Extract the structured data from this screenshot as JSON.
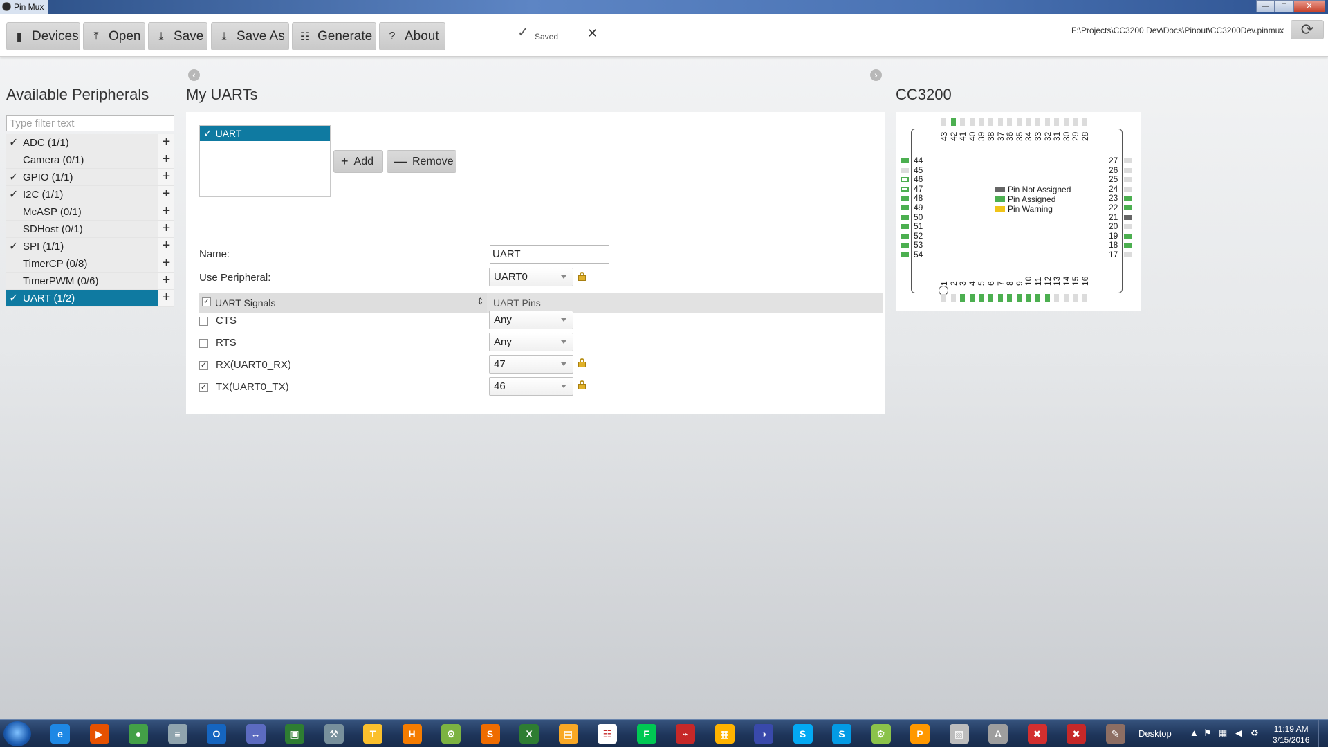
{
  "window": {
    "title": "Pin Mux"
  },
  "toolbar": {
    "buttons": [
      {
        "label": "Devices",
        "icon": "devices-icon"
      },
      {
        "label": "Open",
        "icon": "upload-icon"
      },
      {
        "label": "Save",
        "icon": "download-icon"
      },
      {
        "label": "Save As",
        "icon": "download-icon"
      },
      {
        "label": "Generate",
        "icon": "document-icon"
      },
      {
        "label": "About",
        "icon": "question-icon"
      }
    ],
    "status_text": "Saved",
    "file_path": "F:\\Projects\\CC3200 Dev\\Docs\\Pinout\\CC3200Dev.pinmux"
  },
  "left": {
    "title": "Available Peripherals",
    "filter_placeholder": "Type filter text",
    "items": [
      {
        "label": "ADC (1/1)",
        "checked": true,
        "selected": false
      },
      {
        "label": "Camera (0/1)",
        "checked": false,
        "selected": false
      },
      {
        "label": "GPIO (1/1)",
        "checked": true,
        "selected": false
      },
      {
        "label": "I2C (1/1)",
        "checked": true,
        "selected": false
      },
      {
        "label": "McASP (0/1)",
        "checked": false,
        "selected": false
      },
      {
        "label": "SDHost (0/1)",
        "checked": false,
        "selected": false
      },
      {
        "label": "SPI (1/1)",
        "checked": true,
        "selected": false
      },
      {
        "label": "TimerCP (0/8)",
        "checked": false,
        "selected": false
      },
      {
        "label": "TimerPWM (0/6)",
        "checked": false,
        "selected": false
      },
      {
        "label": "UART (1/2)",
        "checked": true,
        "selected": true
      }
    ]
  },
  "center": {
    "title": "My UARTs",
    "instances": [
      "UART"
    ],
    "add_label": "Add",
    "remove_label": "Remove",
    "name_label": "Name:",
    "name_value": "UART",
    "use_peripheral_label": "Use Peripheral:",
    "use_peripheral_value": "UART0",
    "signals_header": "UART Signals",
    "pins_header": "UART Pins",
    "signals": [
      {
        "name": "CTS",
        "checked": false,
        "pin": "Any",
        "locked": false
      },
      {
        "name": "RTS",
        "checked": false,
        "pin": "Any",
        "locked": false
      },
      {
        "name": "RX(UART0_RX)",
        "checked": true,
        "pin": "47",
        "locked": true
      },
      {
        "name": "TX(UART0_TX)",
        "checked": true,
        "pin": "46",
        "locked": true
      }
    ]
  },
  "chip": {
    "title": "CC3200",
    "legend": [
      {
        "label": "Pin Not Assigned",
        "color": "#666666"
      },
      {
        "label": "Pin Assigned",
        "color": "#4caf50"
      },
      {
        "label": "Pin Warning",
        "color": "#f0c419"
      }
    ],
    "colors": {
      "assigned": "#4caf50",
      "unassigned": "#dcdcdc",
      "not_assigned": "#666666"
    },
    "top_pins": [
      "43",
      "42",
      "41",
      "40",
      "39",
      "38",
      "37",
      "36",
      "35",
      "34",
      "33",
      "32",
      "31",
      "30",
      "29",
      "28"
    ],
    "bottom_pins": [
      "1",
      "2",
      "3",
      "4",
      "5",
      "6",
      "7",
      "8",
      "9",
      "10",
      "11",
      "12",
      "13",
      "14",
      "15",
      "16"
    ],
    "left_pins": [
      "44",
      "45",
      "46",
      "47",
      "48",
      "49",
      "50",
      "51",
      "52",
      "53",
      "54"
    ],
    "right_pins": [
      "27",
      "26",
      "25",
      "24",
      "23",
      "22",
      "21",
      "20",
      "19",
      "18",
      "17"
    ],
    "top_state": [
      "u",
      "a",
      "u",
      "u",
      "u",
      "u",
      "u",
      "u",
      "u",
      "u",
      "u",
      "u",
      "u",
      "u",
      "u",
      "u"
    ],
    "bottom_state": [
      "u",
      "u",
      "a",
      "a",
      "a",
      "a",
      "a",
      "a",
      "a",
      "a",
      "a",
      "a",
      "u",
      "u",
      "u",
      "u"
    ],
    "left_state": [
      "a",
      "u",
      "s",
      "s",
      "a",
      "a",
      "a",
      "a",
      "a",
      "a",
      "a"
    ],
    "right_state": [
      "u",
      "u",
      "u",
      "u",
      "a",
      "a",
      "n",
      "u",
      "a",
      "a",
      "u"
    ]
  },
  "taskbar": {
    "desktop_label": "Desktop",
    "time": "11:19 AM",
    "date": "3/15/2016"
  }
}
